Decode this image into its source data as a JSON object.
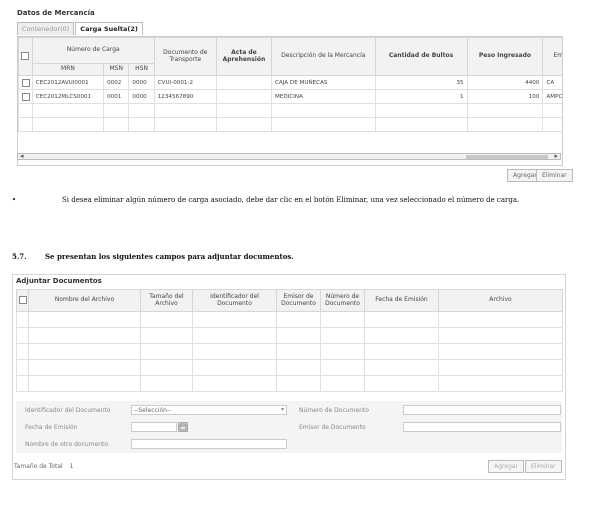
{
  "merch": {
    "title": "Datos de Mercancía",
    "tabs": [
      {
        "label": "Contenedor(0)",
        "active": false
      },
      {
        "label": "Carga Suelta(2)",
        "active": true
      }
    ],
    "headers": {
      "numero_carga": "Número de Carga",
      "mrn": "MRN",
      "msn": "MSN",
      "hsn": "HSN",
      "documento": "Documento de Transporte",
      "acta": "Acta de Aprehensión",
      "descripcion": "Descripción de la Mercancía",
      "cantidad": "Cantidad de Bultos",
      "peso": "Peso Ingresado",
      "extra": "Emb"
    },
    "rows": [
      {
        "mrn": "CEC2012AVUI0001",
        "msn": "0002",
        "hsn": "0000",
        "documento": "CVUI-0001-2",
        "acta": "",
        "descripcion": "CAJA DE MUÑECAS",
        "cantidad": "35",
        "peso": "4400",
        "extra": "CA"
      },
      {
        "mrn": "CEC2012MLCS0001",
        "msn": "0001",
        "hsn": "0000",
        "documento": "1234567890",
        "acta": "",
        "descripcion": "MEDICINA",
        "cantidad": "1",
        "peso": "100",
        "extra": "AMPOLL"
      }
    ],
    "buttons": {
      "add": "Agregar",
      "delete": "Eliminar"
    }
  },
  "bullet_text": "Si desea eliminar algún número de carga asociado, debe dar clic en el botón Eliminar, una vez seleccionado el número de carga.",
  "section": {
    "number": "5.7.",
    "text": "Se presentan los siguientes campos para adjuntar documentos."
  },
  "attach": {
    "title": "Adjuntar Documentos",
    "headers": {
      "nombre": "Nombre del Archivo",
      "tamano": "Tamaño del Archivo",
      "identificador": "Identificador del Documento",
      "emisor": "Emisor de Documento",
      "numero": "Número de Documento",
      "fecha": "Fecha de Emisión",
      "archivo": "Archivo"
    },
    "form": {
      "identificador_label": "Identificador del Documento",
      "identificador_value": "--Selección--",
      "numero_label": "Número de Documento",
      "fecha_label": "Fecha de Emisión",
      "emisor_label": "Emisor de Documento",
      "otro_label": "Nombre de otro documento"
    },
    "total_label": "Tamaño de Total",
    "total_value": "1",
    "buttons": {
      "add": "Agregar",
      "delete": "Eliminar"
    }
  },
  "icons": {
    "bullet": "•",
    "calendar": "calendar-icon",
    "dropdown": "chevron-down-icon",
    "scroll_left": "◂",
    "scroll_right": "▸"
  }
}
